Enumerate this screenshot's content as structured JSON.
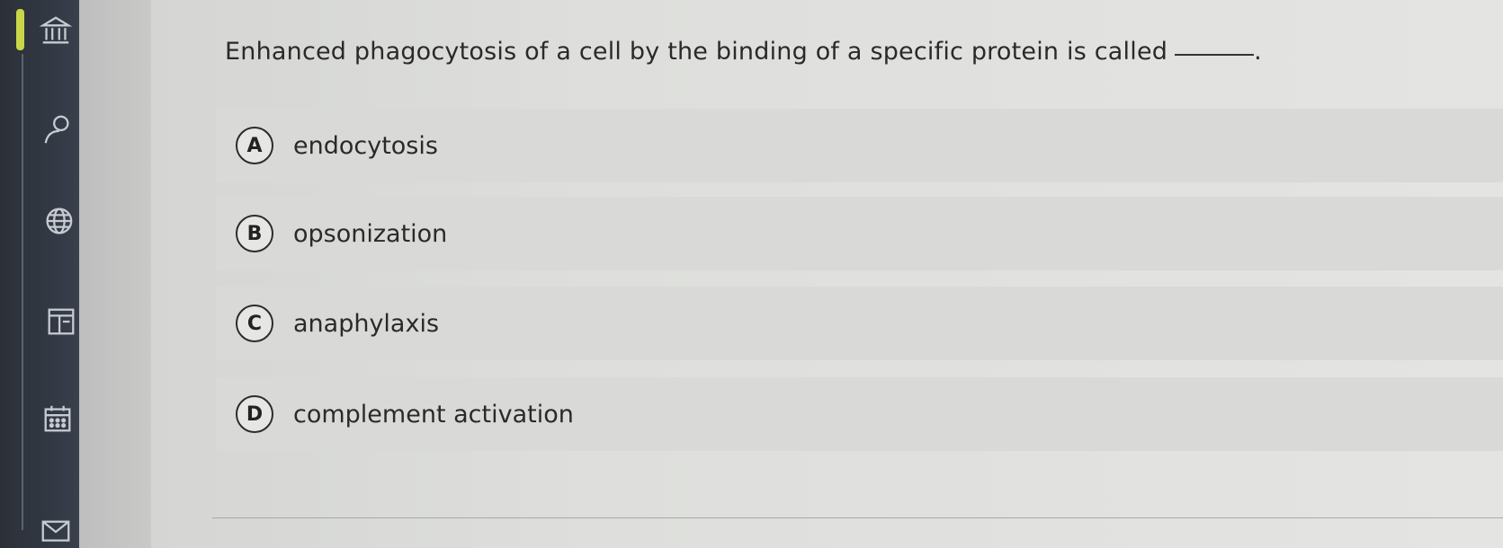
{
  "question": {
    "text": "Enhanced phagocytosis of a cell by the binding of a specific protein is called",
    "trailing": "."
  },
  "options": [
    {
      "letter": "A",
      "text": "endocytosis"
    },
    {
      "letter": "B",
      "text": "opsonization"
    },
    {
      "letter": "C",
      "text": "anaphylaxis"
    },
    {
      "letter": "D",
      "text": "complement activation"
    }
  ],
  "sidebar": {
    "icons": [
      "bank-icon",
      "user-icon",
      "globe-icon",
      "layout-icon",
      "calendar-icon",
      "mail-icon"
    ],
    "accent_color": "#c9d64a"
  }
}
